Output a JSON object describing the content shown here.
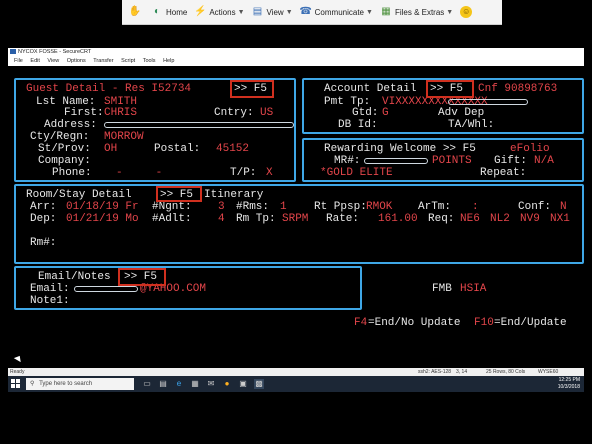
{
  "toolbar": {
    "home": "Home",
    "actions": "Actions",
    "view": "View",
    "communicate": "Communicate",
    "files": "Files & Extras"
  },
  "window": {
    "title": "NYCOX FOSSE - SecureCRT",
    "menu": [
      "File",
      "Edit",
      "View",
      "Options",
      "Transfer",
      "Script",
      "Tools",
      "Help"
    ]
  },
  "guest": {
    "header": "Guest Detail - Res I52734",
    "f5": ">> F5",
    "lst_label": "Lst Name:",
    "lst_value": "SMITH",
    "first_label": "First:",
    "first_value": "CHRIS",
    "cntry_label": "Cntry:",
    "cntry_value": "US",
    "address_label": "Address:",
    "city_label": "Cty/Regn:",
    "city_value": "MORROW",
    "state_label": "St/Prov:",
    "state_value": "OH",
    "postal_label": "Postal:",
    "postal_value": "45152",
    "company_label": "Company:",
    "phone_label": "Phone:",
    "phone_value": "-     -",
    "tp_label": "T/P:",
    "tp_value": "X"
  },
  "account": {
    "header": "Account Detail",
    "f5": ">> F5",
    "cnf": "Cnf 90898763",
    "pmt_label": "Pmt Tp:",
    "pmt_value": "VIXXXXXXXXXXXXXX",
    "gtd_label": "Gtd:",
    "gtd_value": "G",
    "adv_label": "Adv Dep",
    "db_label": "DB Id:",
    "ta_label": "TA/Whl:"
  },
  "rewards": {
    "header": "Rewarding Welcome >> F5",
    "efolio": "eFolio",
    "mr_label": "MR#:",
    "points": "POINTS",
    "gift_label": "Gift:",
    "gift_value": "N/A",
    "tier": "*GOLD ELITE",
    "repeat_label": "Repeat:"
  },
  "stay": {
    "header": "Room/Stay Detail",
    "f5": ">> F5",
    "itinerary": "Itinerary",
    "arr_label": "Arr:",
    "arr_value": "01/18/19 Fr",
    "ngnt_label": "#Ngnt:",
    "ngnt_value": "3",
    "rms_label": "#Rms:",
    "rms_value": "1",
    "rt_label": "Rt Ppsp:",
    "rt_value": "RMOK",
    "artm_label": "ArTm:",
    "artm_value": ":",
    "conf_label": "Conf:",
    "conf_value": "N",
    "dep_label": "Dep:",
    "dep_value": "01/21/19 Mo",
    "adlt_label": "#Adlt:",
    "adlt_value": "4",
    "rmtp_label": "Rm Tp:",
    "rmtp_value": "SRPM",
    "rate_label": "Rate:",
    "rate_value": "161.00",
    "req_label": "Req:",
    "req_ne": "NE6",
    "req_nl": "NL2",
    "req_nv": "NV9",
    "req_nx": "NX1",
    "rm_label": "Rm#:"
  },
  "email": {
    "header": "Email/Notes",
    "f5": ">> F5",
    "email_label": "Email:",
    "email_value": "@YAHOO.COM",
    "note_label": "Note1:",
    "fmb": "FMB",
    "hsia": "HSIA"
  },
  "function_keys": {
    "f4": "F4",
    "f4_text": "=End/No Update",
    "f10": "F10",
    "f10_text": "=End/Update"
  },
  "status": {
    "ready": "Ready",
    "ssh": "ssh2: AES-128",
    "pos": "3, 14",
    "size": "25 Rows, 80 Cols",
    "term": "WYSE60"
  },
  "taskbar": {
    "search_placeholder": "Type here to search",
    "time": "12:25 PM",
    "date": "10/3/2018"
  },
  "colors": {
    "highlight_red": "#d0301f",
    "highlight_blue": "#3fa7e6",
    "terminal_red": "#e2454a"
  }
}
